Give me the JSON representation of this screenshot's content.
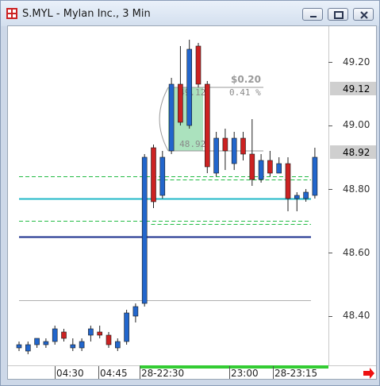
{
  "window": {
    "title": "S.MYL - Mylan Inc., 3 Min",
    "buttons": [
      "minimize",
      "restore",
      "close"
    ]
  },
  "chart_data": {
    "type": "candlestick",
    "symbol": "S.MYL",
    "y_ticks": [
      "49.20",
      "49.00",
      "48.80",
      "48.60",
      "48.40"
    ],
    "ylim": [
      48.18,
      49.35
    ],
    "price_tags": [
      {
        "label": "49.12",
        "value": 49.12
      },
      {
        "label": "48.92",
        "value": 48.92
      }
    ],
    "x_labels": [
      "04:30",
      "04:45",
      "28-22:30",
      "23:00",
      "28-23:15"
    ],
    "candles": [
      {
        "o": 48.3,
        "h": 48.32,
        "l": 48.29,
        "c": 48.31
      },
      {
        "o": 48.29,
        "h": 48.32,
        "l": 48.28,
        "c": 48.31
      },
      {
        "o": 48.31,
        "h": 48.33,
        "l": 48.3,
        "c": 48.33
      },
      {
        "o": 48.31,
        "h": 48.33,
        "l": 48.3,
        "c": 48.32
      },
      {
        "o": 48.32,
        "h": 48.37,
        "l": 48.31,
        "c": 48.36
      },
      {
        "o": 48.35,
        "h": 48.36,
        "l": 48.32,
        "c": 48.33
      },
      {
        "o": 48.3,
        "h": 48.33,
        "l": 48.29,
        "c": 48.31
      },
      {
        "o": 48.3,
        "h": 48.33,
        "l": 48.29,
        "c": 48.32
      },
      {
        "o": 48.34,
        "h": 48.37,
        "l": 48.32,
        "c": 48.36
      },
      {
        "o": 48.35,
        "h": 48.37,
        "l": 48.33,
        "c": 48.34
      },
      {
        "o": 48.34,
        "h": 48.35,
        "l": 48.3,
        "c": 48.31
      },
      {
        "o": 48.3,
        "h": 48.33,
        "l": 48.29,
        "c": 48.32
      },
      {
        "o": 48.32,
        "h": 48.42,
        "l": 48.31,
        "c": 48.41
      },
      {
        "o": 48.4,
        "h": 48.44,
        "l": 48.38,
        "c": 48.43
      },
      {
        "o": 48.44,
        "h": 48.91,
        "l": 48.43,
        "c": 48.9
      },
      {
        "o": 48.93,
        "h": 48.94,
        "l": 48.74,
        "c": 48.76
      },
      {
        "o": 48.78,
        "h": 48.92,
        "l": 48.77,
        "c": 48.9
      },
      {
        "o": 48.92,
        "h": 49.15,
        "l": 48.91,
        "c": 49.13
      },
      {
        "o": 49.13,
        "h": 49.25,
        "l": 49.0,
        "c": 49.01
      },
      {
        "o": 49.0,
        "h": 49.27,
        "l": 48.99,
        "c": 49.24
      },
      {
        "o": 49.25,
        "h": 49.26,
        "l": 49.12,
        "c": 49.13
      },
      {
        "o": 49.13,
        "h": 49.14,
        "l": 48.85,
        "c": 48.87
      },
      {
        "o": 48.85,
        "h": 48.98,
        "l": 48.84,
        "c": 48.96
      },
      {
        "o": 48.96,
        "h": 48.99,
        "l": 48.86,
        "c": 48.92
      },
      {
        "o": 48.88,
        "h": 48.98,
        "l": 48.86,
        "c": 48.96
      },
      {
        "o": 48.96,
        "h": 48.98,
        "l": 48.89,
        "c": 48.91
      },
      {
        "o": 48.91,
        "h": 49.02,
        "l": 48.81,
        "c": 48.83
      },
      {
        "o": 48.83,
        "h": 48.91,
        "l": 48.82,
        "c": 48.89
      },
      {
        "o": 48.89,
        "h": 48.92,
        "l": 48.84,
        "c": 48.85
      },
      {
        "o": 48.85,
        "h": 48.9,
        "l": 48.85,
        "c": 48.88
      },
      {
        "o": 48.88,
        "h": 48.9,
        "l": 48.73,
        "c": 48.77
      },
      {
        "o": 48.77,
        "h": 48.79,
        "l": 48.73,
        "c": 48.78
      },
      {
        "o": 48.77,
        "h": 48.8,
        "l": 48.76,
        "c": 48.79
      },
      {
        "o": 48.78,
        "h": 48.93,
        "l": 48.77,
        "c": 48.9
      }
    ],
    "horizontal_lines": [
      {
        "value": 48.84,
        "color": "#22bb44",
        "style": "dashed",
        "from": "start",
        "to": "chart-right"
      },
      {
        "value": 48.77,
        "color": "#22b8c8",
        "style": "solid",
        "from": "start",
        "to": "chart-right"
      },
      {
        "value": 48.7,
        "color": "#22bb44",
        "style": "dashed",
        "from": "start",
        "to": "chart-right"
      },
      {
        "value": 48.83,
        "color": "#22bb44",
        "style": "dashed",
        "from": "candle-15",
        "to": "chart-right"
      },
      {
        "value": 48.69,
        "color": "#22bb44",
        "style": "dashed",
        "from": "candle-15",
        "to": "chart-right"
      },
      {
        "value": 48.65,
        "color": "#1a2e8c",
        "style": "solid",
        "from": "start",
        "to": "chart-right"
      },
      {
        "value": 48.45,
        "color": "#b0b0b0",
        "style": "solid",
        "from": "start",
        "to": "chart-right"
      }
    ],
    "measure_tool": {
      "change_label": "$0.20",
      "percent_label": "0.41 %",
      "high_label": "49.12",
      "low_label": "48.92",
      "high_value": 49.12,
      "low_value": 48.92
    },
    "colors": {
      "up": "#2266cc",
      "down": "#cc2222",
      "session_bar": "#33cc33",
      "measure_fill": "#8fd8a8",
      "arrow": "#ee1111"
    }
  }
}
